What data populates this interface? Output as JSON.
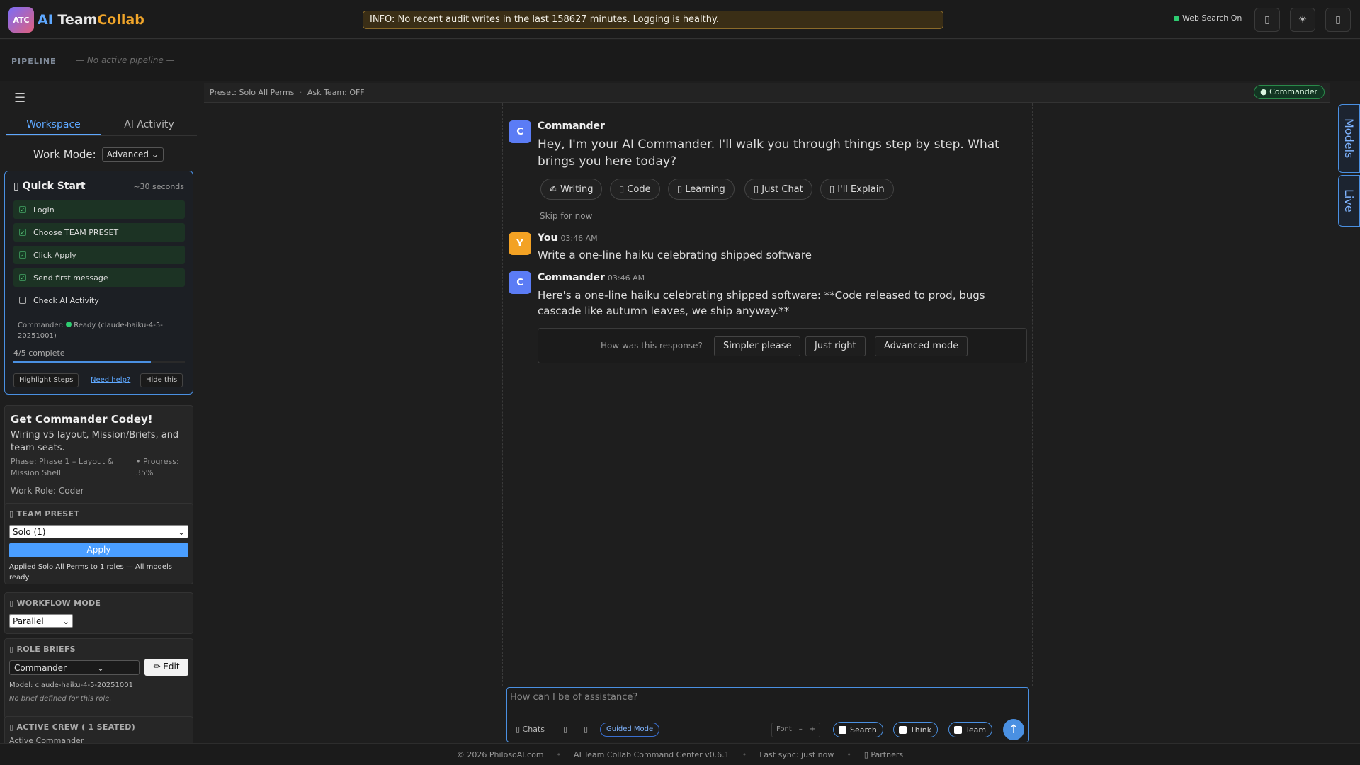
{
  "app": {
    "logo_badge": "ATC",
    "title_a": "AI",
    "title_b": "Team",
    "title_c": "Collab"
  },
  "banner": {
    "text": "INFO: No recent audit writes in the last 158627 minutes. Logging is healthy."
  },
  "topbar": {
    "web_search": "Web Search On",
    "icons": [
      "monitor-icon",
      "sun-icon",
      "panel-icon"
    ],
    "sun_glyph": "☀",
    "box_glyph": "▯"
  },
  "pipeline": {
    "label": "PIPELINE",
    "status": "— No active pipeline —"
  },
  "sidebar": {
    "tabs": [
      "Workspace",
      "AI Activity"
    ],
    "work_mode_label": "Work Mode:",
    "work_mode_value": "Advanced",
    "quick_start": {
      "title": "Quick Start",
      "time": "~30 seconds",
      "items": [
        {
          "label": "Login",
          "done": true
        },
        {
          "label": "Choose TEAM PRESET",
          "done": true
        },
        {
          "label": "Click Apply",
          "done": true
        },
        {
          "label": "Send first message",
          "done": true
        },
        {
          "label": "Check AI Activity",
          "done": false
        }
      ],
      "commander_status": "Commander:",
      "commander_status_rest": "Ready (claude-haiku-4-5-20251001)",
      "progress_label": "4/5 complete",
      "progress": 0.8,
      "highlight_btn": "Highlight Steps",
      "help_link": "Need help?",
      "hide_btn": "Hide this"
    },
    "codey": {
      "title": "Get Commander Codey!",
      "subtitle": "Wiring v5 layout, Mission/Briefs, and team seats.",
      "phase": "Phase: Phase 1 – Layout & Mission Shell",
      "progress": "Progress: 35%",
      "role": "Work Role: Coder"
    },
    "team_preset": {
      "title": "TEAM PRESET",
      "value": "Solo (1)",
      "apply": "Apply",
      "note": "Applied Solo All Perms to 1 roles — All models ready"
    },
    "workflow": {
      "title": "WORKFLOW MODE",
      "value": "Parallel"
    },
    "role_briefs": {
      "title": "ROLE BRIEFS",
      "value": "Commander",
      "edit": "✏ Edit",
      "model": "Model: claude-haiku-4-5-20251001",
      "note": "No brief defined for this role."
    },
    "active_crew": {
      "title": "ACTIVE CREW ( 1 SEATED)",
      "first": "Active Commander"
    }
  },
  "subbar": {
    "preset": "Preset: Solo All Perms",
    "dot": "·",
    "ask_team": "Ask Team: OFF",
    "badge": "● Commander"
  },
  "chat": {
    "messages": [
      {
        "avatar": "C",
        "name": "Commander",
        "time": "",
        "text": "Hey, I'm your AI Commander. I'll walk you through things step by step. What brings you here today?"
      },
      {
        "avatar": "Y",
        "name": "You",
        "time": "03:46 AM",
        "text": "Write a one-line haiku celebrating shipped software"
      },
      {
        "avatar": "C",
        "name": "Commander",
        "time": "03:46 AM",
        "text": "Here's a one-line haiku celebrating shipped software: **Code released to prod, bugs cascade like autumn leaves, we ship anyway.**"
      }
    ],
    "chips": [
      "✍ Writing",
      "▯ Code",
      "▯ Learning",
      "▯ Just Chat",
      "▯ I'll Explain"
    ],
    "skip": "Skip for now",
    "feedback": {
      "question": "How was this response?",
      "buttons": [
        "Simpler please",
        "Just right",
        "Advanced mode"
      ]
    }
  },
  "composer": {
    "placeholder": "How can I be of assistance?",
    "chats": "▯ Chats",
    "box_glyph": "▯",
    "guided": "Guided Mode",
    "font": "Font",
    "minus": "–",
    "plus": "+",
    "toggles": [
      "Search",
      "Think",
      "Team"
    ],
    "send_glyph": "↑"
  },
  "right_tabs": [
    "Models",
    "Live"
  ],
  "footer": {
    "copyright": "© 2026 PhilosoAI.com",
    "version": "AI Team Collab Command Center v0.6.1",
    "sync": "Last sync: just now",
    "partners": "▯ Partners",
    "dot": "•"
  },
  "colors": {
    "accent": "#4a90e2",
    "brand_orange": "#f0a52a",
    "success": "#2ecc71"
  }
}
